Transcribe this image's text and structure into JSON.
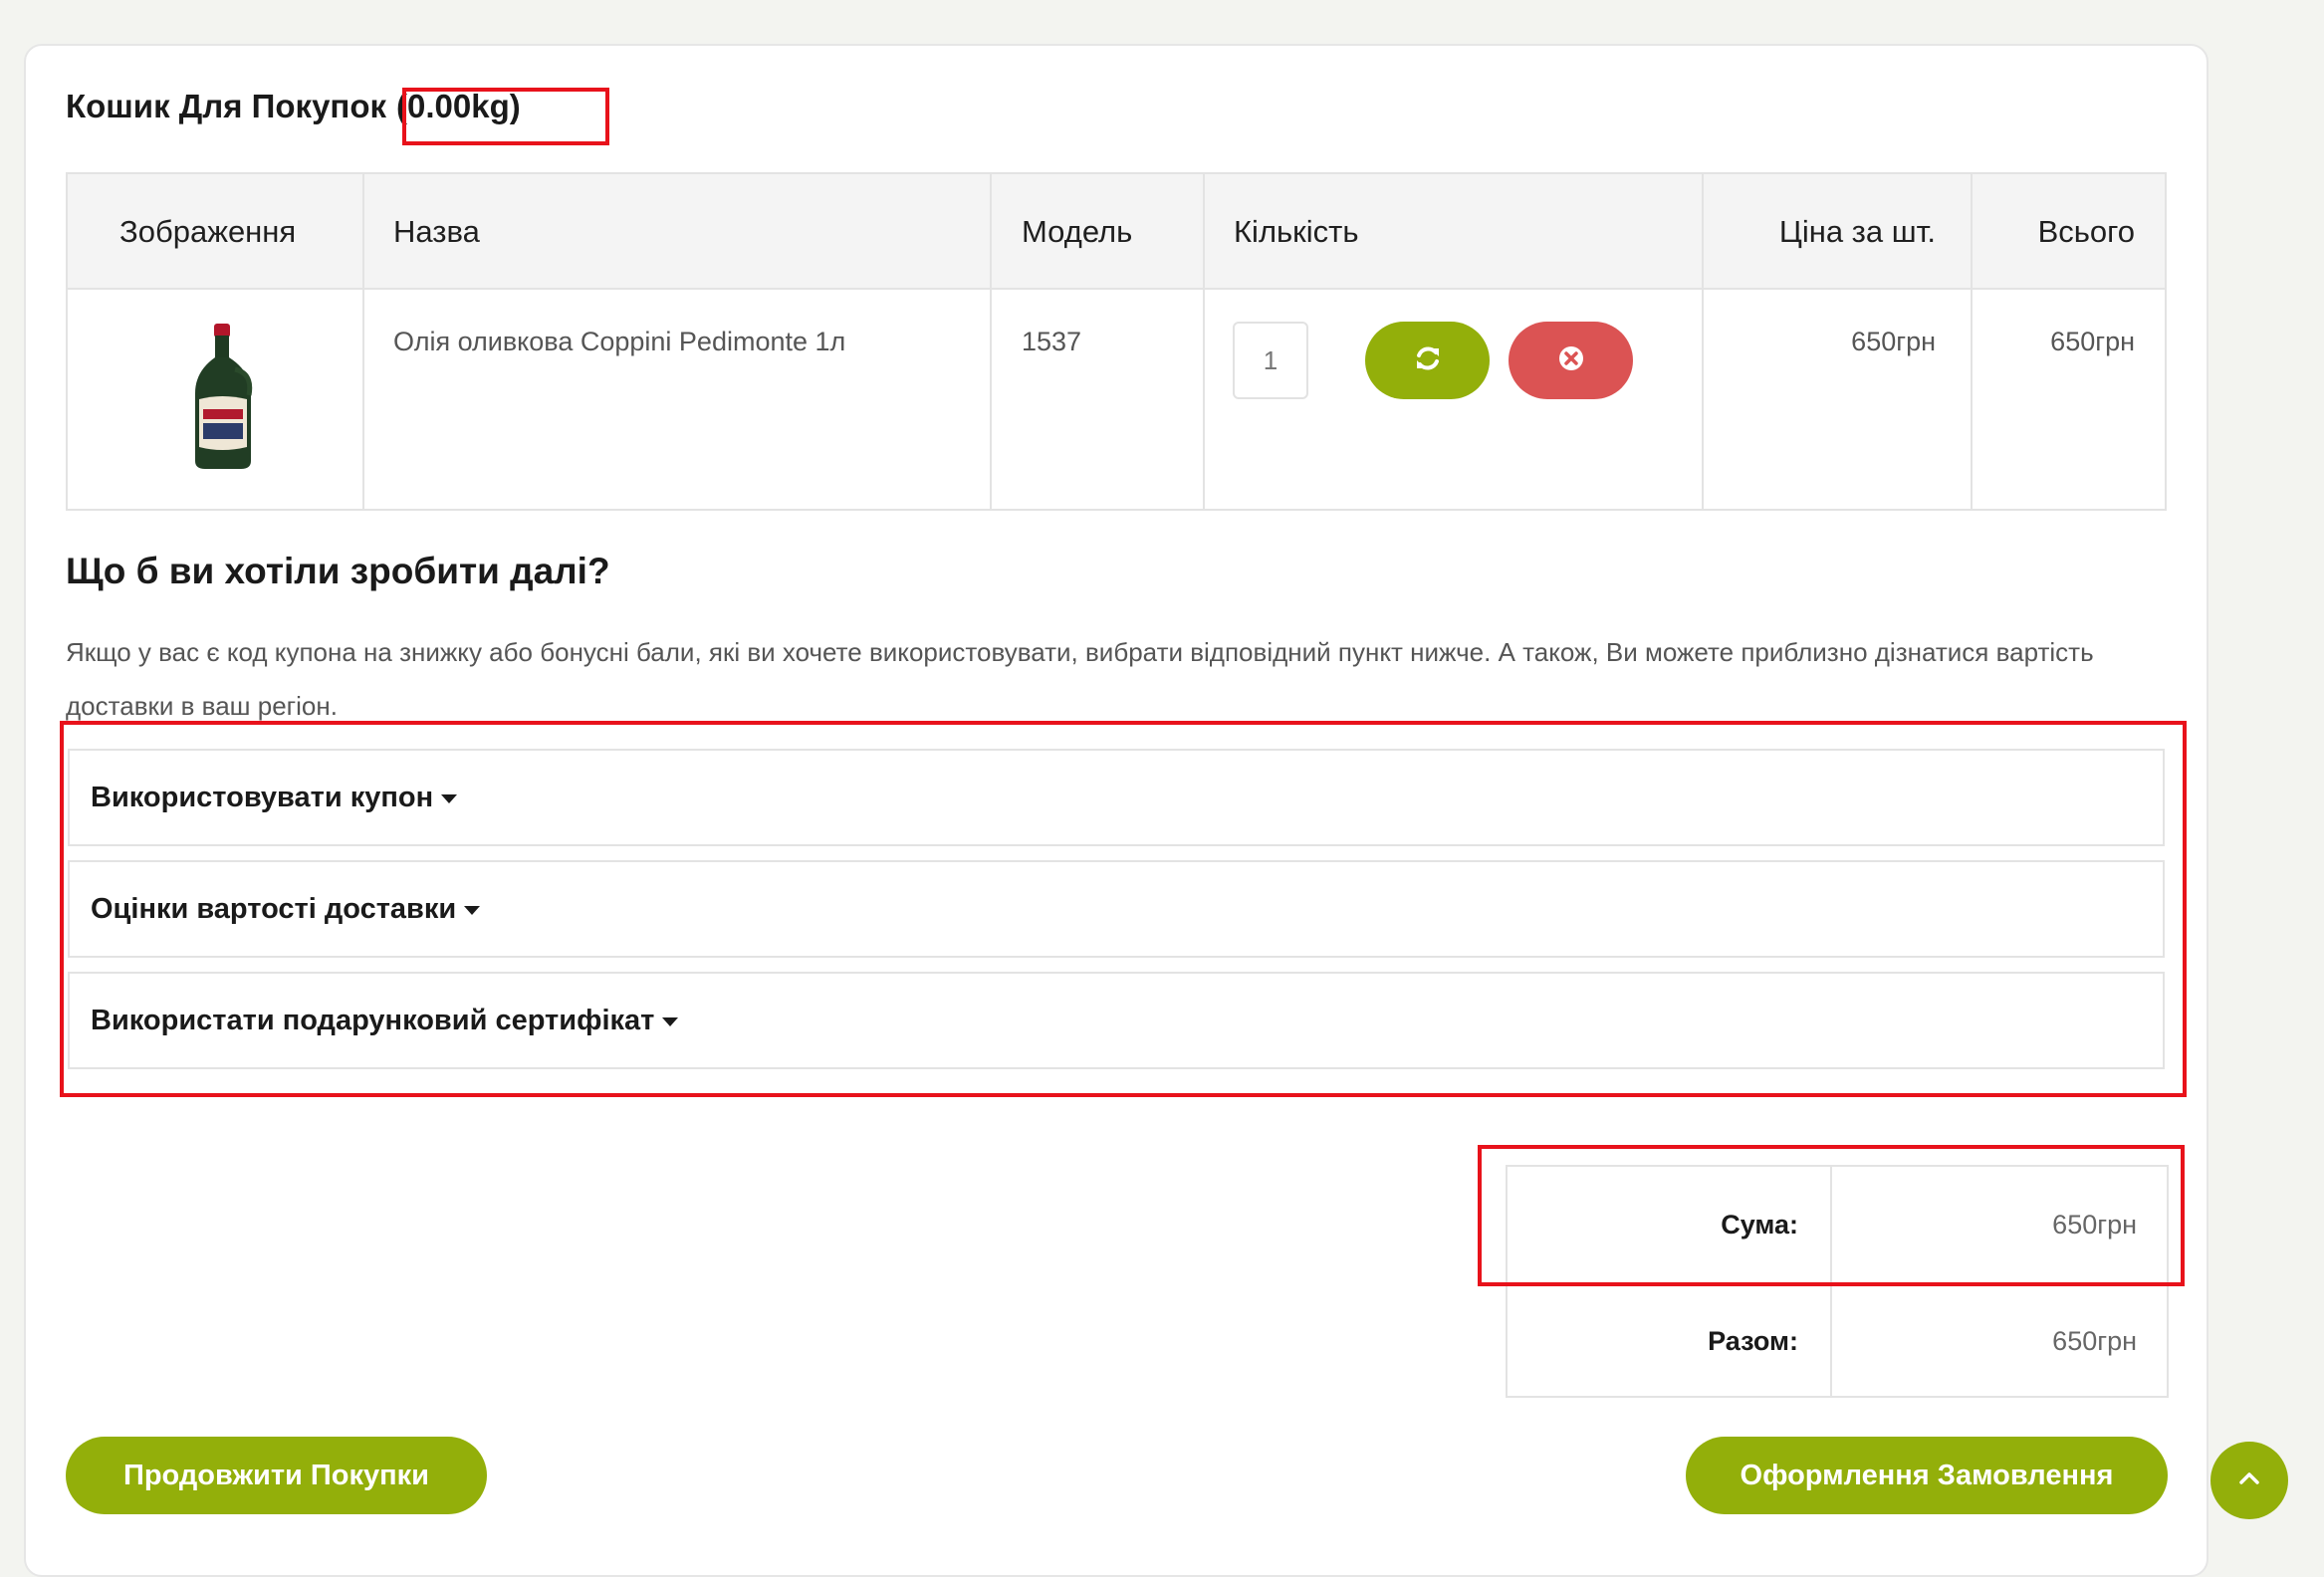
{
  "cart": {
    "title": "Кошик Для Покупок",
    "weight": "(0.00kg)",
    "columns": {
      "image": "Зображення",
      "name": "Назва",
      "model": "Модель",
      "quantity": "Кількість",
      "unit_price": "Ціна за шт.",
      "total": "Всього"
    },
    "items": [
      {
        "name": "Олія оливкова Coppini Pedimonte 1л",
        "model": "1537",
        "quantity": "1",
        "unit_price": "650грн",
        "total": "650грн"
      }
    ]
  },
  "next": {
    "heading": "Що б ви хотіли зробити далі?",
    "text": "Якщо у вас є код купона на знижку або бонусні бали, які ви хочете використовувати, вибрати відповідний пункт нижче. А також, Ви можете приблизно дізнатися вартість доставки в ваш регіон."
  },
  "accordions": [
    {
      "label": "Використовувати купон"
    },
    {
      "label": "Оцінки вартості доставки"
    },
    {
      "label": "Використати подарунковий сертифікат"
    }
  ],
  "totals": [
    {
      "label": "Сума:",
      "value": "650грн"
    },
    {
      "label": "Разом:",
      "value": "650грн"
    }
  ],
  "buttons": {
    "continue": "Продовжити Покупки",
    "checkout": "Оформлення Замовлення"
  },
  "colors": {
    "accent_green": "#93af0a",
    "remove_red": "#db5353",
    "highlight_red": "#e8121b"
  },
  "icons": {
    "refresh": "refresh-icon",
    "remove": "remove-icon",
    "scroll_top": "chevron-up-icon",
    "caret": "caret-down-icon"
  }
}
